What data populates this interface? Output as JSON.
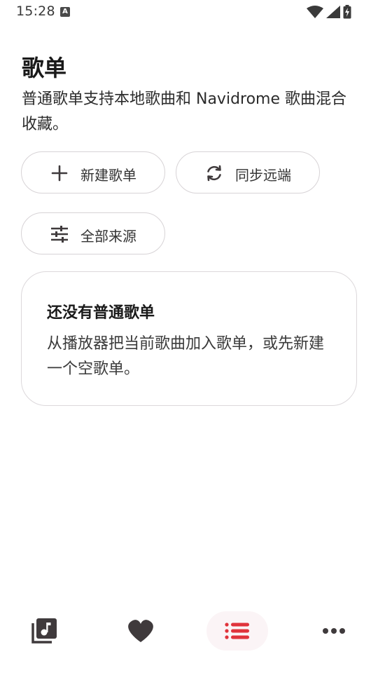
{
  "status_bar": {
    "time": "15:28",
    "notification_glyph": "A",
    "icons": [
      "wifi-icon",
      "cellular-icon",
      "battery-charging-icon"
    ]
  },
  "header": {
    "title": "歌单",
    "description": "普通歌单支持本地歌曲和 Navidrome 歌曲混合收藏。"
  },
  "actions": {
    "new_playlist": "新建歌单",
    "sync_remote": "同步远端",
    "all_sources": "全部来源"
  },
  "empty_state": {
    "title": "还没有普通歌单",
    "description": "从播放器把当前歌曲加入歌单，或先新建一个空歌单。"
  },
  "bottom_nav": {
    "items": [
      {
        "icon": "music-library-icon",
        "selected": false
      },
      {
        "icon": "heart-icon",
        "selected": false
      },
      {
        "icon": "playlist-icon",
        "selected": true
      },
      {
        "icon": "more-horizontal-icon",
        "selected": false
      }
    ],
    "accent_color": "#e0333b"
  },
  "colors": {
    "text": "#1a1a1a",
    "border": "#d7d3d6",
    "accent": "#e0333b",
    "icon": "#3f3a3c"
  }
}
